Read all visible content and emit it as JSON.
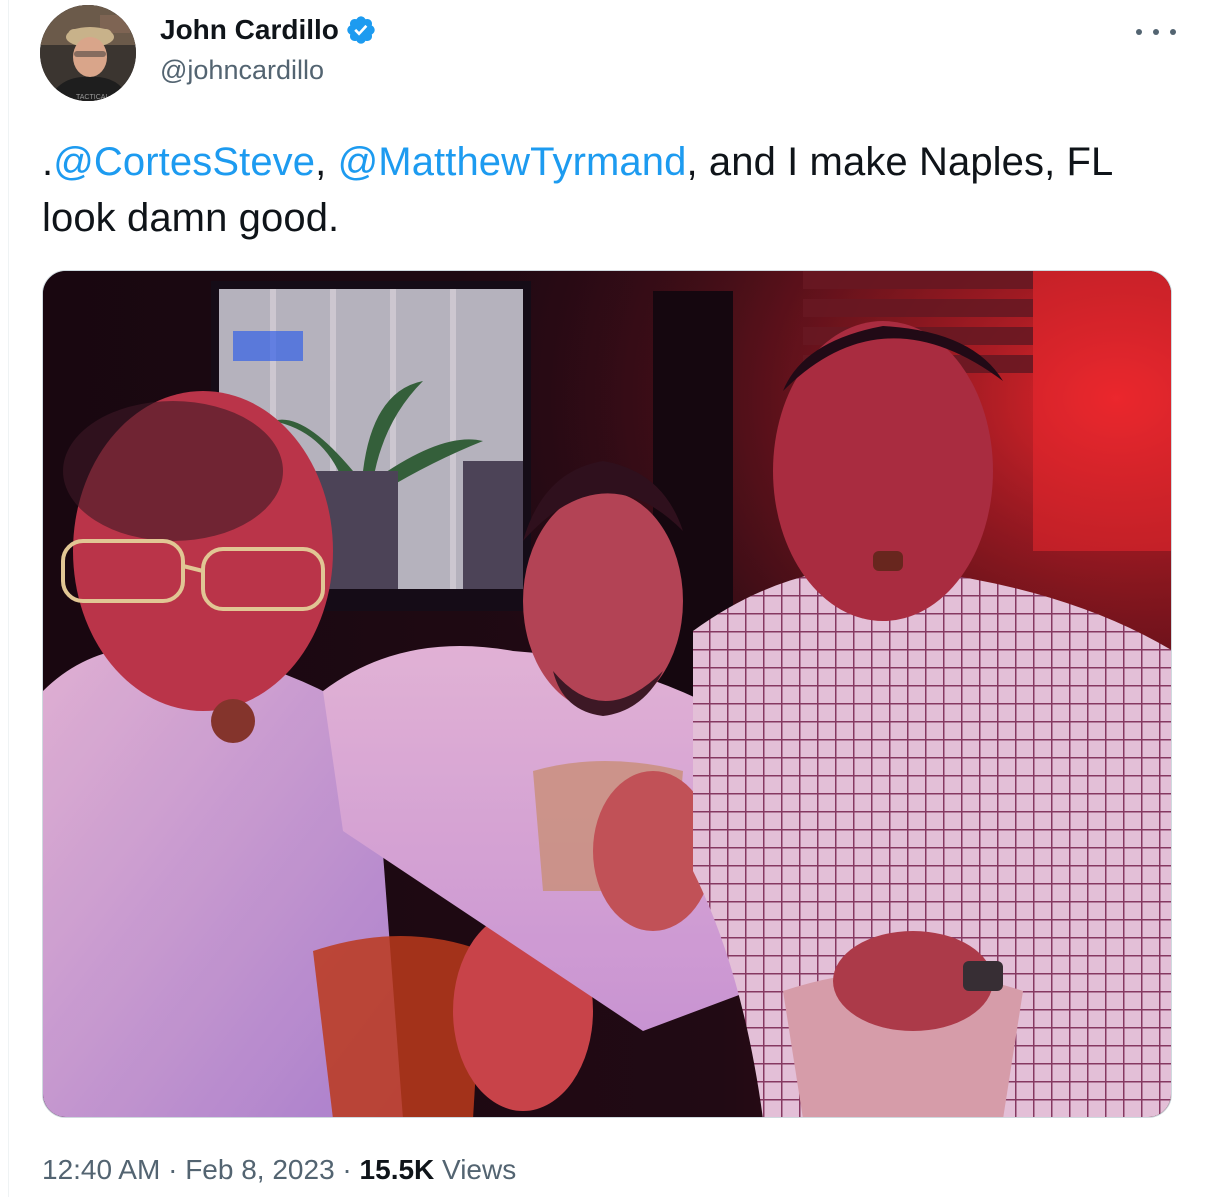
{
  "author": {
    "name": "John Cardillo",
    "handle": "@johncardillo",
    "verified": true,
    "verified_color": "#1d9bf0",
    "avatar_label": "TACTICAL"
  },
  "tweet": {
    "prefix": ".",
    "mention_1": "@CortesSteve",
    "sep_1": ", ",
    "mention_2": "@MatthewTyrmand",
    "rest": ", and I make Naples, FL look damn good.",
    "mention_color": "#1d9bf0"
  },
  "meta": {
    "time": "12:40 AM",
    "dot_1": " · ",
    "date": "Feb 8, 2023",
    "dot_2": " · ",
    "views_count": "15.5K",
    "views_label": " Views"
  },
  "icons": {
    "more": "more-horizontal-icon",
    "verified": "verified-badge-icon"
  }
}
